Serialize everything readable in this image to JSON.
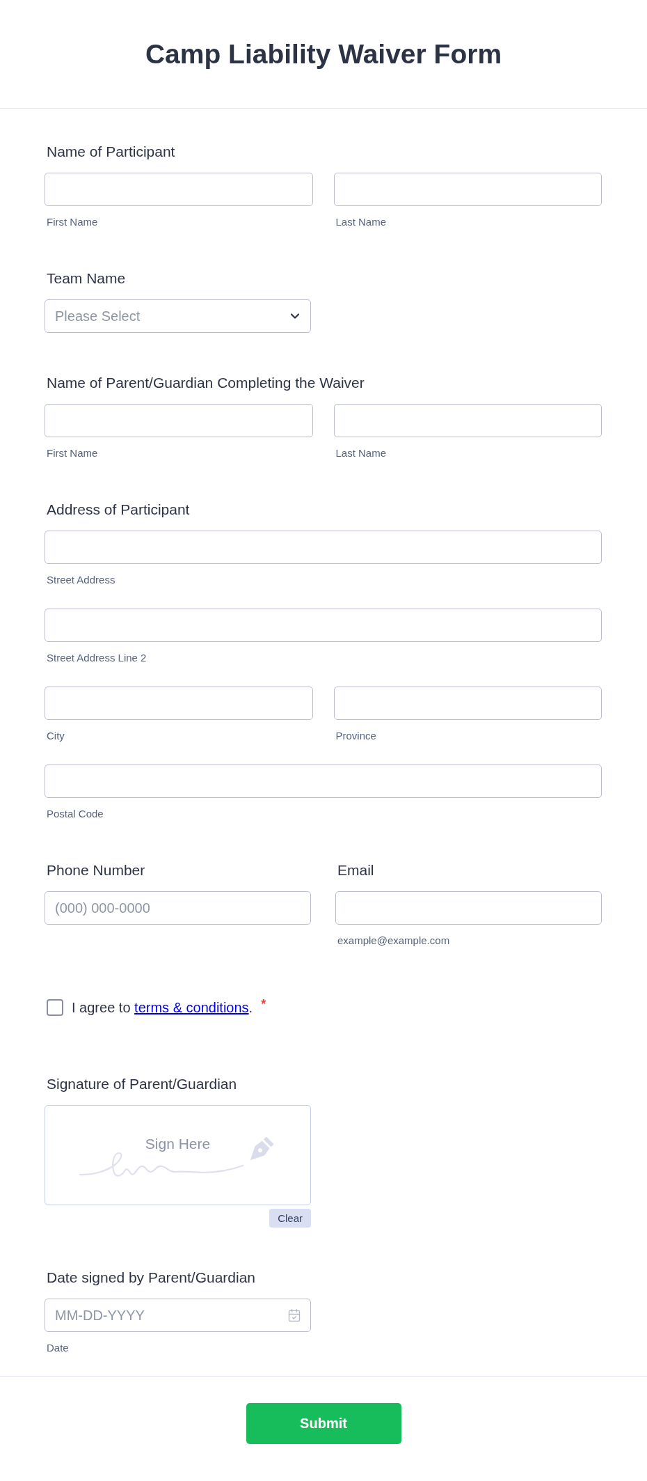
{
  "form": {
    "title": "Camp Liability Waiver Form"
  },
  "fields": [
    {
      "kind": "name",
      "label": "Name of Participant",
      "inputs": [
        {
          "sublabel": "First Name"
        },
        {
          "sublabel": "Last Name"
        }
      ]
    },
    {
      "kind": "select",
      "label": "Team Name",
      "placeholder": "Please Select"
    },
    {
      "kind": "name",
      "label": "Name of Parent/Guardian Completing the Waiver",
      "inputs": [
        {
          "sublabel": "First Name"
        },
        {
          "sublabel": "Last Name"
        }
      ]
    },
    {
      "kind": "address",
      "label": "Address of Participant",
      "rows": [
        {
          "inputs": [
            {
              "sublabel": "Street Address"
            }
          ]
        },
        {
          "inputs": [
            {
              "sublabel": "Street Address Line 2"
            }
          ]
        },
        {
          "inputs": [
            {
              "sublabel": "City"
            },
            {
              "sublabel": "Province"
            }
          ]
        },
        {
          "inputs": [
            {
              "sublabel": "Postal Code"
            }
          ]
        }
      ]
    },
    {
      "kind": "pair",
      "columns": [
        {
          "label": "Phone Number",
          "placeholder": "(000) 000-0000"
        },
        {
          "label": "Email",
          "sublabel": "example@example.com"
        }
      ]
    },
    {
      "kind": "checkbox",
      "checked": false,
      "text": "I agree to",
      "link": "terms & conditions",
      "text_after": ".",
      "required_mark": "*"
    },
    {
      "kind": "signature",
      "label": "Signature of Parent/Guardian",
      "placeholder": "Sign Here",
      "clear_button": "Clear"
    },
    {
      "kind": "date",
      "label": "Date signed by Parent/Guardian",
      "placeholder": "MM-DD-YYYY",
      "sublabel": "Date"
    }
  ],
  "submit_button": "Submit"
}
